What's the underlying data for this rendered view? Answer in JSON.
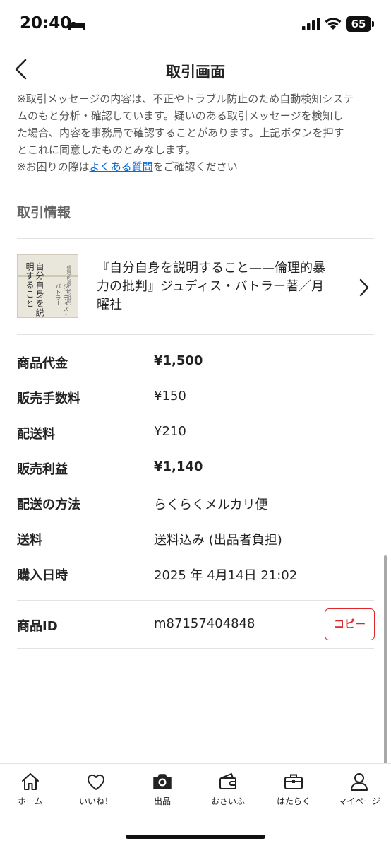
{
  "status_bar": {
    "time": "20:40",
    "battery": "65"
  },
  "nav": {
    "title": "取引画面"
  },
  "notice": {
    "line1": "※取引メッセージの内容は、不正やトラブル防止のため自動検知システ",
    "line2": "ムのもと分析・確認しています。疑いのある取引メッセージを検知し",
    "line3": "た場合、内容を事務局で確認することがあります。上記ボタンを押す",
    "line4": "とこれに同意したものとみなします。",
    "line5_prefix": "※お困りの際は",
    "line5_link": "よくある質問",
    "line5_suffix": "をご確認ください"
  },
  "section": {
    "title": "取引情報"
  },
  "product": {
    "name": "『自分自身を説明すること——倫理的暴力の批判』ジュディス・バトラー著／月曜社",
    "cover_title": "自分自身を説明すること",
    "cover_author": "ジュディス・バトラー",
    "cover_sub": "倫理的暴力の批判"
  },
  "info": {
    "price_label": "商品代金",
    "price_value": "¥1,500",
    "fee_label": "販売手数料",
    "fee_value": "¥150",
    "shipping_label": "配送料",
    "shipping_value": "¥210",
    "profit_label": "販売利益",
    "profit_value": "¥1,140",
    "method_label": "配送の方法",
    "method_value": "らくらくメルカリ便",
    "postage_label": "送料",
    "postage_value": "送料込み (出品者負担)",
    "date_label": "購入日時",
    "date_value": "2025 年 4月14日 21:02",
    "id_label": "商品ID",
    "id_value": "m87157404848",
    "copy_label": "コピー"
  },
  "tabs": [
    {
      "label": "ホーム",
      "icon": "home-icon"
    },
    {
      "label": "いいね！",
      "icon": "heart-icon"
    },
    {
      "label": "出品",
      "icon": "camera-icon"
    },
    {
      "label": "おさいふ",
      "icon": "wallet-icon"
    },
    {
      "label": "はたらく",
      "icon": "briefcase-icon"
    },
    {
      "label": "マイページ",
      "icon": "person-icon"
    }
  ],
  "colors": {
    "accent_red": "#e0262d",
    "link_blue": "#0b6bd3",
    "divider": "#e3e3e3"
  }
}
